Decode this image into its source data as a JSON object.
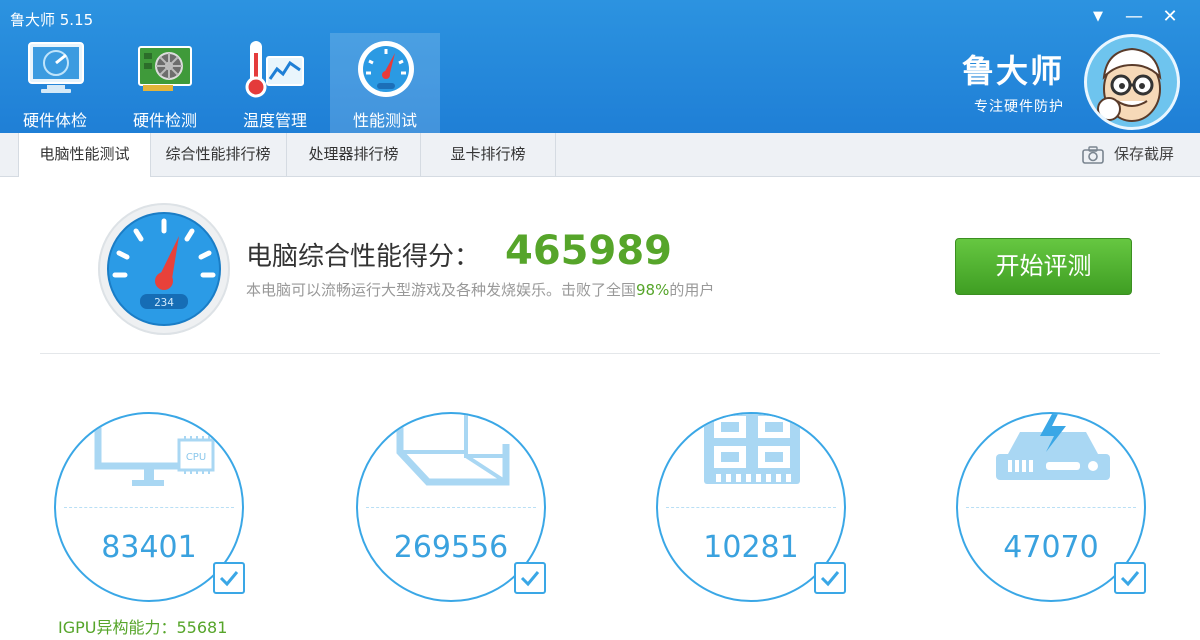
{
  "app": {
    "title": "鲁大师 5.15"
  },
  "window_controls": {
    "menu_glyph": "▼",
    "minimize_glyph": "—",
    "close_glyph": "✕"
  },
  "nav": {
    "items": [
      {
        "label": "硬件体检",
        "icon": "monitor-check-icon"
      },
      {
        "label": "硬件检测",
        "icon": "graphics-card-icon"
      },
      {
        "label": "温度管理",
        "icon": "thermometer-icon"
      },
      {
        "label": "性能测试",
        "icon": "speedometer-icon",
        "active": true
      }
    ]
  },
  "brand": {
    "name": "鲁大师",
    "slogan": "专注硬件防护"
  },
  "tabs": {
    "items": [
      {
        "label": "电脑性能测试",
        "active": true
      },
      {
        "label": "综合性能排行榜"
      },
      {
        "label": "处理器排行榜"
      },
      {
        "label": "显卡排行榜"
      }
    ],
    "save_screenshot": "保存截屏"
  },
  "score": {
    "label": "电脑综合性能得分：",
    "value": "465989",
    "desc_prefix": "本电脑可以流畅运行大型游戏及各种发烧娱乐。击败了全国",
    "desc_pct": "98%",
    "desc_suffix": "的用户",
    "gauge_readout": "234",
    "start_button": "开始评测"
  },
  "components": [
    {
      "name": "cpu",
      "value": "83401",
      "icon_label": "CPU",
      "checked": true
    },
    {
      "name": "gpu",
      "value": "269556",
      "checked": true
    },
    {
      "name": "memory",
      "value": "10281",
      "checked": true
    },
    {
      "name": "disk",
      "value": "47070",
      "checked": true
    }
  ],
  "igpu": {
    "text": "IGPU异构能力：55681"
  },
  "colors": {
    "header_blue": "#1f7fd6",
    "score_green": "#56a52a",
    "circle_blue": "#3aa7e6",
    "button_green": "#4fae2c"
  }
}
